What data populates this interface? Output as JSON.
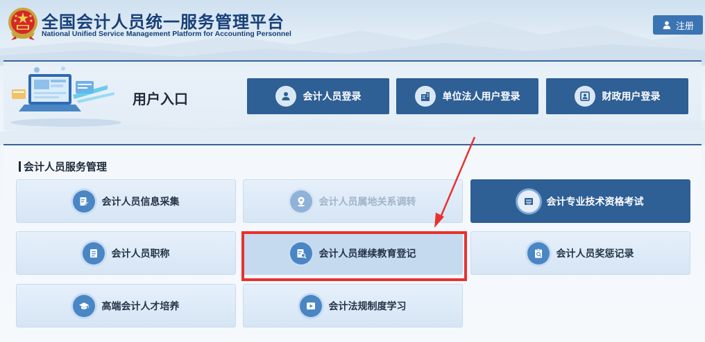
{
  "header": {
    "title_cn": "全国会计人员统一服务管理平台",
    "title_en": "National Unified Service Management Platform for Accounting Personnel",
    "register_label": "注册",
    "register_icon": "user-icon"
  },
  "entry": {
    "title": "用户入口",
    "buttons": [
      {
        "label": "会计人员登录",
        "icon": "user-circle-icon"
      },
      {
        "label": "单位法人用户登录",
        "icon": "building-icon"
      },
      {
        "label": "财政用户登录",
        "icon": "id-card-icon"
      }
    ]
  },
  "services": {
    "section_title": "会计人员服务管理",
    "items": [
      {
        "label": "会计人员信息采集",
        "icon": "edit-form-icon",
        "state": "normal"
      },
      {
        "label": "会计人员属地关系调转",
        "icon": "location-icon",
        "state": "disabled"
      },
      {
        "label": "会计专业技术资格考试",
        "icon": "exam-icon",
        "state": "active"
      },
      {
        "label": "会计人员职称",
        "icon": "document-icon",
        "state": "normal"
      },
      {
        "label": "会计人员继续教育登记",
        "icon": "document-search-icon",
        "state": "highlighted"
      },
      {
        "label": "会计人员奖惩记录",
        "icon": "clipboard-search-icon",
        "state": "normal"
      },
      {
        "label": "高端会计人才培养",
        "icon": "graduation-cap-icon",
        "state": "normal"
      },
      {
        "label": "会计法规制度学习",
        "icon": "video-play-icon",
        "state": "normal"
      }
    ]
  },
  "colors": {
    "primary": "#2e5f95",
    "register": "#3b74b3",
    "title": "#173f78",
    "annotation_red": "#e9302f"
  }
}
